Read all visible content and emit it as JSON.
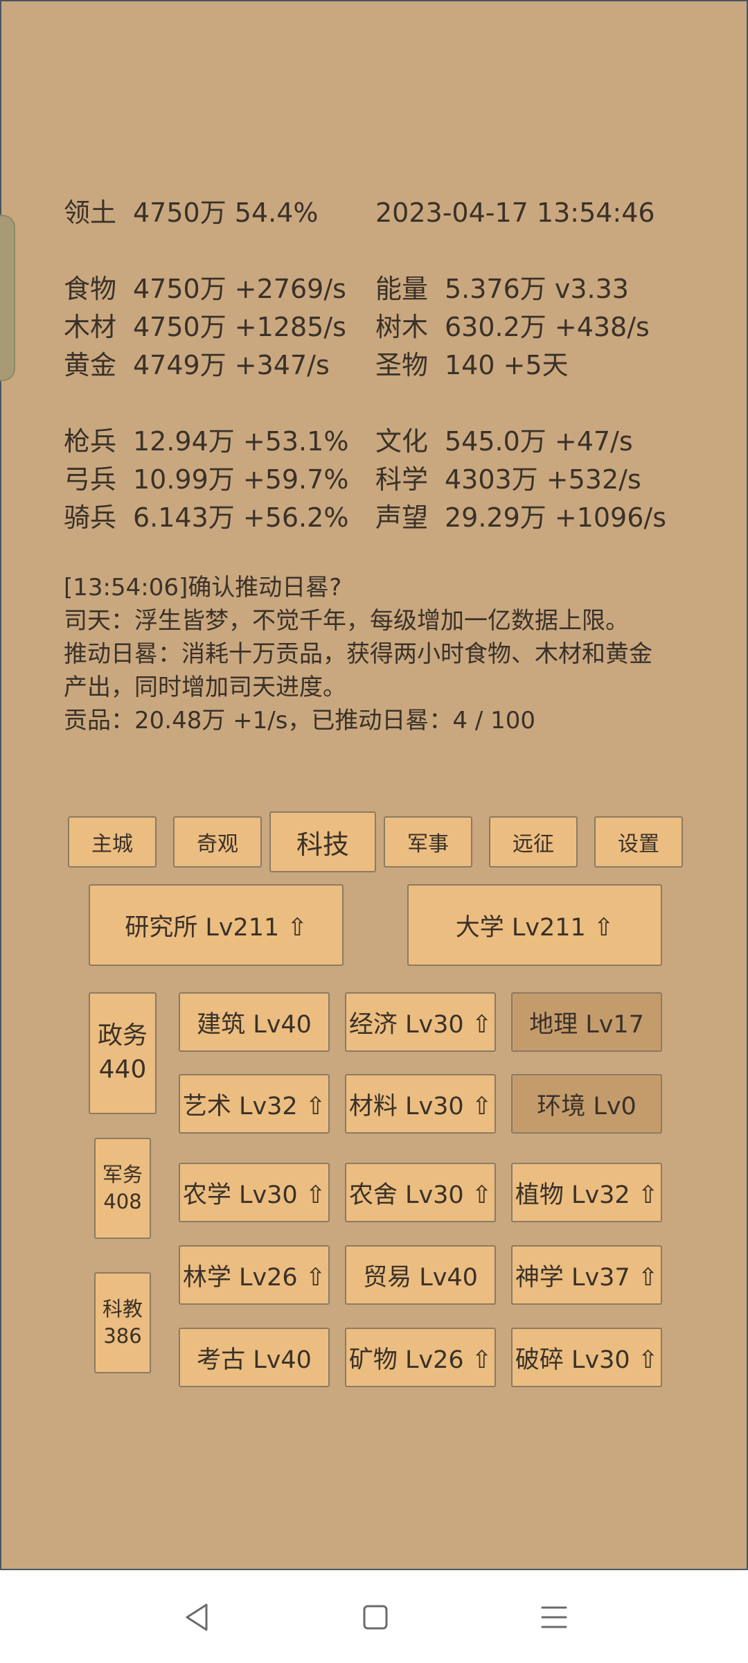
{
  "stats": {
    "territory": {
      "label": "领土",
      "value": "4750万  54.4%"
    },
    "datetime": "2023-04-17 13:54:46",
    "food": {
      "label": "食物",
      "value": "4750万 +2769/s"
    },
    "wood": {
      "label": "木材",
      "value": "4750万 +1285/s"
    },
    "gold": {
      "label": "黄金",
      "value": "4749万 +347/s"
    },
    "energy": {
      "label": "能量",
      "value": "5.376万  v3.33"
    },
    "trees": {
      "label": "树木",
      "value": "630.2万 +438/s"
    },
    "relics": {
      "label": "圣物",
      "value": "140 +5天"
    },
    "spearmen": {
      "label": "枪兵",
      "value": "12.94万 +53.1%"
    },
    "archers": {
      "label": "弓兵",
      "value": "10.99万 +59.7%"
    },
    "cavalry": {
      "label": "骑兵",
      "value": "6.143万 +56.2%"
    },
    "culture": {
      "label": "文化",
      "value": "545.0万 +47/s"
    },
    "science": {
      "label": "科学",
      "value": "4303万 +532/s"
    },
    "prestige": {
      "label": "声望",
      "value": "29.29万 +1096/s"
    }
  },
  "log": [
    "[13:54:06]确认推动日晷?",
    "司天：浮生皆梦，不觉千年，每级增加一亿数据上限。",
    "推动日晷：消耗十万贡品，获得两小时食物、木材和黄金",
    "产出，同时增加司天进度。",
    "贡品：20.48万 +1/s，已推动日晷：4 / 100"
  ],
  "tabs": [
    "主城",
    "奇观",
    "科技",
    "军事",
    "远征",
    "设置"
  ],
  "active_tab": "科技",
  "main_buildings": [
    "研究所 Lv211 ⇧",
    "大学 Lv211 ⇧"
  ],
  "sidebar": {
    "politics": {
      "label": "政务",
      "value": "440"
    },
    "military": {
      "label": "军务",
      "value": "408"
    },
    "education": {
      "label": "科教",
      "value": "386"
    }
  },
  "techs": [
    {
      "label": "建筑 Lv40",
      "dim": false
    },
    {
      "label": "经济 Lv30 ⇧",
      "dim": false
    },
    {
      "label": "地理 Lv17",
      "dim": true
    },
    {
      "label": "艺术 Lv32 ⇧",
      "dim": false
    },
    {
      "label": "材料 Lv30 ⇧",
      "dim": false
    },
    {
      "label": "环境 Lv0",
      "dim": true
    },
    {
      "label": "农学 Lv30 ⇧",
      "dim": false
    },
    {
      "label": "农舍 Lv30 ⇧",
      "dim": false
    },
    {
      "label": "植物 Lv32 ⇧",
      "dim": false
    },
    {
      "label": "林学 Lv26 ⇧",
      "dim": false
    },
    {
      "label": "贸易 Lv40",
      "dim": false
    },
    {
      "label": "神学 Lv37 ⇧",
      "dim": false
    },
    {
      "label": "考古 Lv40",
      "dim": false
    },
    {
      "label": "矿物 Lv26 ⇧",
      "dim": false
    },
    {
      "label": "破碎 Lv30 ⇧",
      "dim": false
    }
  ],
  "colors": {
    "background": "#c9a880",
    "button": "#ebbd80",
    "button_dim": "#c49c6c",
    "text": "#3a3128"
  },
  "nav_icons": [
    "back-triangle-icon",
    "home-square-icon",
    "menu-lines-icon"
  ]
}
